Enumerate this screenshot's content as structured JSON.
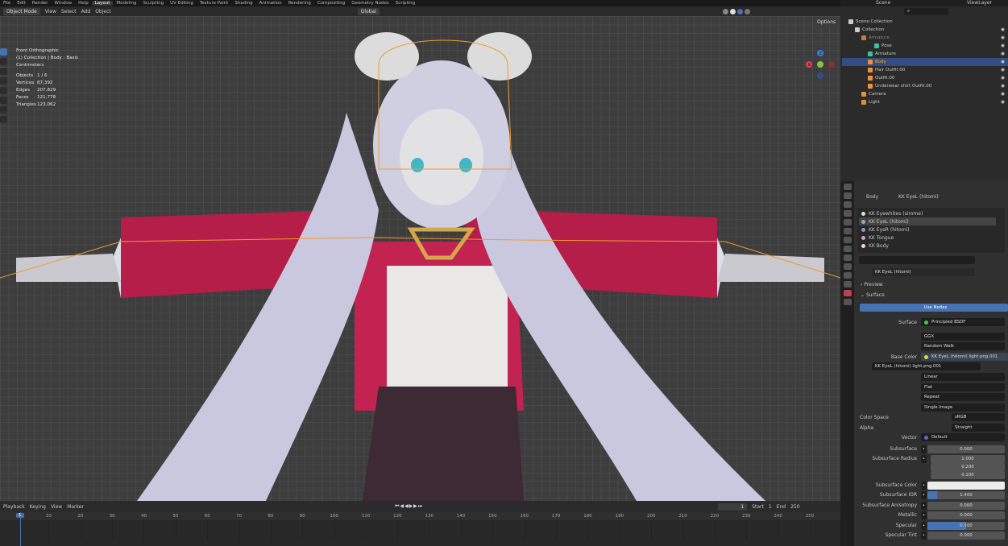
{
  "menu": [
    "File",
    "Edit",
    "Render",
    "Window",
    "Help"
  ],
  "workspaces": [
    "Layout",
    "Modeling",
    "Sculpting",
    "UV Editing",
    "Texture Paint",
    "Shading",
    "Animation",
    "Rendering",
    "Compositing",
    "Geometry Nodes",
    "Scripting"
  ],
  "viewport_header": {
    "mode": "Object Mode",
    "menus": [
      "View",
      "Select",
      "Add",
      "Object"
    ],
    "orientation": "Global",
    "options": "Options"
  },
  "overlay": {
    "view": "Front Orthographic",
    "context": "(1) Collection | Body : Basis",
    "units": "Centimeters",
    "stats": [
      [
        "Objects",
        "1 / 6"
      ],
      [
        "Vertices",
        "87,392"
      ],
      [
        "Edges",
        "207,829"
      ],
      [
        "Faces",
        "121,778"
      ],
      [
        "Triangles",
        "123,062"
      ]
    ]
  },
  "gizmo": {
    "x": "X",
    "y": "Y",
    "z": "Z"
  },
  "timeline": {
    "menus": [
      "Playback",
      "Keying",
      "View",
      "Marker"
    ],
    "current_frame": "1",
    "start_label": "Start",
    "start": "1",
    "end_label": "End",
    "end": "250",
    "ticks": [
      "1",
      "10",
      "20",
      "30",
      "40",
      "50",
      "60",
      "70",
      "80",
      "90",
      "100",
      "110",
      "120",
      "130",
      "140",
      "150",
      "160",
      "170",
      "180",
      "190",
      "200",
      "210",
      "220",
      "230",
      "240",
      "250"
    ]
  },
  "topright": {
    "scene": "Scene",
    "view_layer": "ViewLayer"
  },
  "outliner": [
    {
      "label": "Scene Collection",
      "indent": 0,
      "icon": "#ccc"
    },
    {
      "label": "Collection",
      "indent": 1,
      "icon": "#ccc",
      "check": true
    },
    {
      "label": "Armature",
      "indent": 2,
      "icon": "#c87a3a",
      "dim": true
    },
    {
      "label": "Pose",
      "indent": 4,
      "icon": "#3fbf9f"
    },
    {
      "label": "Armature",
      "indent": 3,
      "icon": "#3fbf9f"
    },
    {
      "label": "Body",
      "indent": 3,
      "icon": "#f0923a",
      "selected": true
    },
    {
      "label": "Hair Outfit.00",
      "indent": 3,
      "icon": "#f0923a"
    },
    {
      "label": "Outfit.00",
      "indent": 3,
      "icon": "#f0923a"
    },
    {
      "label": "Underwear shirt Outfit.00",
      "indent": 3,
      "icon": "#f0923a"
    },
    {
      "label": "Camera",
      "indent": 2,
      "icon": "#e0903a"
    },
    {
      "label": "Light",
      "indent": 2,
      "icon": "#e0903a"
    }
  ],
  "properties": {
    "breadcrumb": [
      "Body",
      "KK EyeL (hitomi)"
    ],
    "materials": [
      {
        "label": "KK Eyewhites (sirome)",
        "color": "#ddd"
      },
      {
        "label": "KK EyeL (hitomi)",
        "color": "#9ab",
        "selected": true
      },
      {
        "label": "KK EyeR (hitomi)",
        "color": "#89c"
      },
      {
        "label": "KK Tongue",
        "color": "#d9a0a8"
      },
      {
        "label": "KK Body",
        "color": "#eed8d0"
      }
    ],
    "material_name": "KK EyeL (hitomi)",
    "preview": "Preview",
    "surface_panel": "Surface",
    "use_nodes": "Use Nodes",
    "surface_label": "Surface",
    "surface_value": "Principled BSDF",
    "distribution": "GGX",
    "subsurface_method": "Random Walk",
    "base_color_label": "Base Color",
    "base_color_value": "KK EyeL (hitomi) light.png.001",
    "image": "KK EyeL (hitomi) light.png.001",
    "interpolation": "Linear",
    "projection": "Flat",
    "extension": "Repeat",
    "source": "Single Image",
    "color_space_label": "Color Space",
    "color_space": "sRGB",
    "alpha_label": "Alpha",
    "alpha": "Straight",
    "vector_label": "Vector",
    "vector": "Default",
    "fields": [
      {
        "label": "Subsurface",
        "value": "0.000",
        "fill": 0
      },
      {
        "label": "Subsurface Radius",
        "value": "1.000"
      },
      {
        "label": "",
        "value": "0.200"
      },
      {
        "label": "",
        "value": "0.100"
      },
      {
        "label": "Subsurface Color",
        "value": "",
        "white": true
      },
      {
        "label": "Subsurface IOR",
        "value": "1.400",
        "fill": 0.13
      },
      {
        "label": "Subsurface Anisotropy",
        "value": "0.000",
        "fill": 0
      },
      {
        "label": "Metallic",
        "value": "0.000",
        "fill": 0
      },
      {
        "label": "Specular",
        "value": "0.500",
        "fill": 0.5
      },
      {
        "label": "Specular Tint",
        "value": "0.000",
        "fill": 0
      }
    ]
  }
}
